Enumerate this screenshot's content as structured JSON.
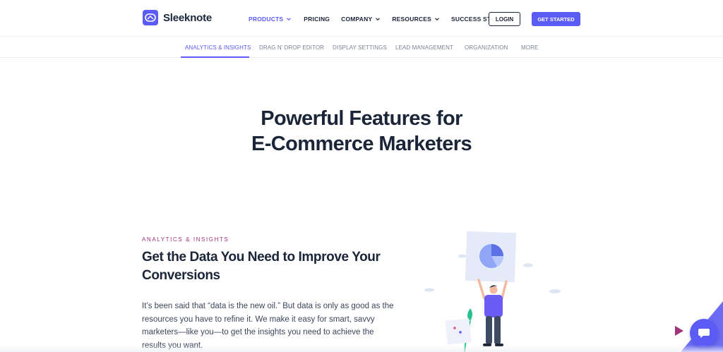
{
  "header": {
    "logo_text": "Sleeknote",
    "nav": [
      {
        "label": "PRODUCTS",
        "has_dropdown": true,
        "active": true
      },
      {
        "label": "PRICING",
        "has_dropdown": false,
        "active": false
      },
      {
        "label": "COMPANY",
        "has_dropdown": true,
        "active": false
      },
      {
        "label": "RESOURCES",
        "has_dropdown": true,
        "active": false
      },
      {
        "label": "SUCCESS STORIES",
        "has_dropdown": false,
        "active": false
      }
    ],
    "login_label": "LOGIN",
    "cta_label": "GET STARTED"
  },
  "subnav": {
    "items": [
      {
        "label": "ANALYTICS & INSIGHTS",
        "active": true
      },
      {
        "label": "DRAG N' DROP EDITOR",
        "active": false
      },
      {
        "label": "DISPLAY SETTINGS",
        "active": false
      },
      {
        "label": "LEAD MANAGEMENT",
        "active": false
      },
      {
        "label": "ORGANIZATION",
        "active": false
      },
      {
        "label": "MORE",
        "active": false
      }
    ]
  },
  "hero": {
    "title_lines": [
      "Powerful Features for",
      "E-Commerce Marketers"
    ]
  },
  "section": {
    "eyebrow": "ANALYTICS & INSIGHTS",
    "title_lines": [
      "Get the Data You Need to Improve Your",
      "Conversions"
    ],
    "body_lines": [
      "It’s been said that “data is the new oil.” But data is only as good as the",
      "resources you have to refine it. We make it easy for smart, savvy",
      "marketers—like you—to get the insights you need to achieve the",
      "results you want."
    ]
  },
  "icons": {
    "logo": "sleeknote-logo-icon",
    "chevron": "chevron-down-icon",
    "chat": "chat-bubble-icon",
    "pie": "pie-chart-icon"
  },
  "colors": {
    "brand": "#5b5bf5",
    "text_dark": "#1b2538",
    "eyebrow": "#a0337a",
    "muted": "#7b8394"
  }
}
